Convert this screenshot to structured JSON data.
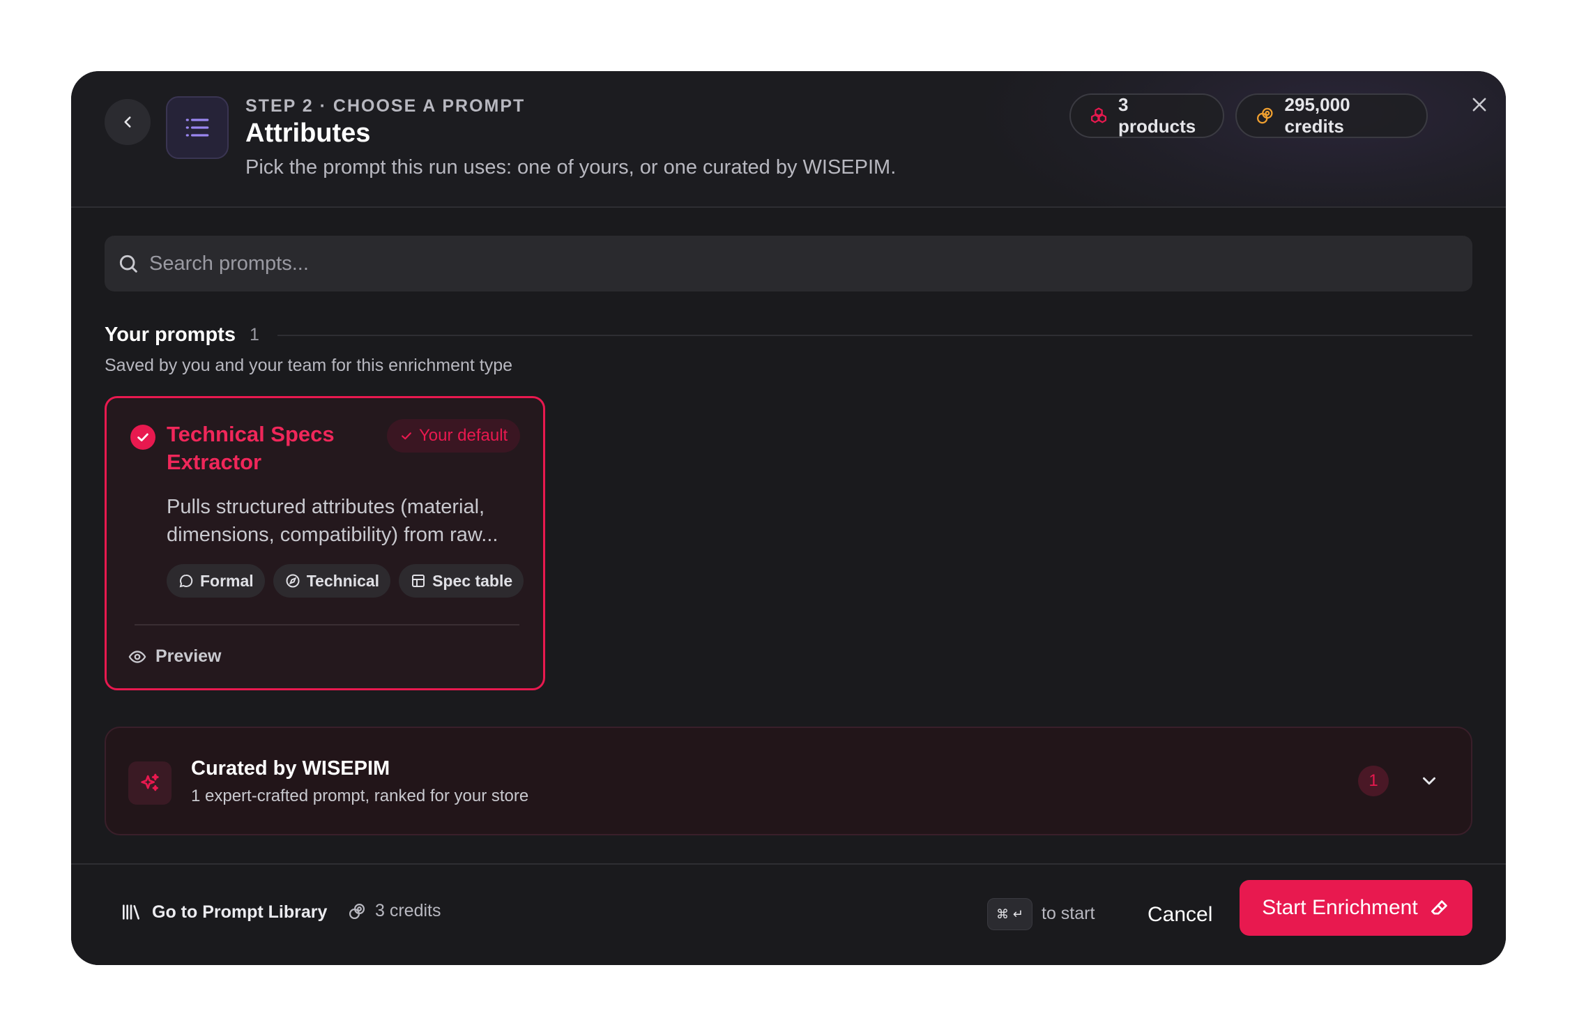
{
  "header": {
    "step_label": "STEP 2 · CHOOSE A PROMPT",
    "title": "Attributes",
    "subtitle": "Pick the prompt this run uses: one of yours, or one curated by WISEPIM.",
    "products_pill": "3 products",
    "credits_pill": "295,000 credits",
    "icons": {
      "back": "chevron-left-icon",
      "menu": "list-icon",
      "products": "cubes-icon",
      "credits": "coins-icon",
      "close": "close-icon"
    },
    "colors": {
      "products_icon": "#e8194f",
      "credits_icon": "#f0a030"
    }
  },
  "search": {
    "placeholder": "Search prompts..."
  },
  "your_prompts": {
    "title": "Your prompts",
    "count": "1",
    "subtitle": "Saved by you and your team for this enrichment type",
    "cards": [
      {
        "title": "Technical Specs Extractor",
        "badge": "Your default",
        "description": "Pulls structured attributes (material, dimensions, compatibility) from raw...",
        "tags": [
          {
            "label": "Formal",
            "icon": "speech-bubble-icon"
          },
          {
            "label": "Technical",
            "icon": "compass-icon"
          },
          {
            "label": "Spec table",
            "icon": "table-icon"
          }
        ],
        "preview_label": "Preview",
        "selected": true
      }
    ]
  },
  "curated": {
    "title": "Curated by WISEPIM",
    "subtitle": "1 expert-crafted prompt, ranked for your store",
    "count": "1"
  },
  "footer": {
    "library_link": "Go to Prompt Library",
    "credits": "3 credits",
    "shortcut": "⌘ ↵",
    "shortcut_hint": "to start",
    "cancel_label": "Cancel",
    "start_label": "Start Enrichment"
  },
  "colors": {
    "accent": "#e8194f",
    "background": "#1a1a1d"
  }
}
